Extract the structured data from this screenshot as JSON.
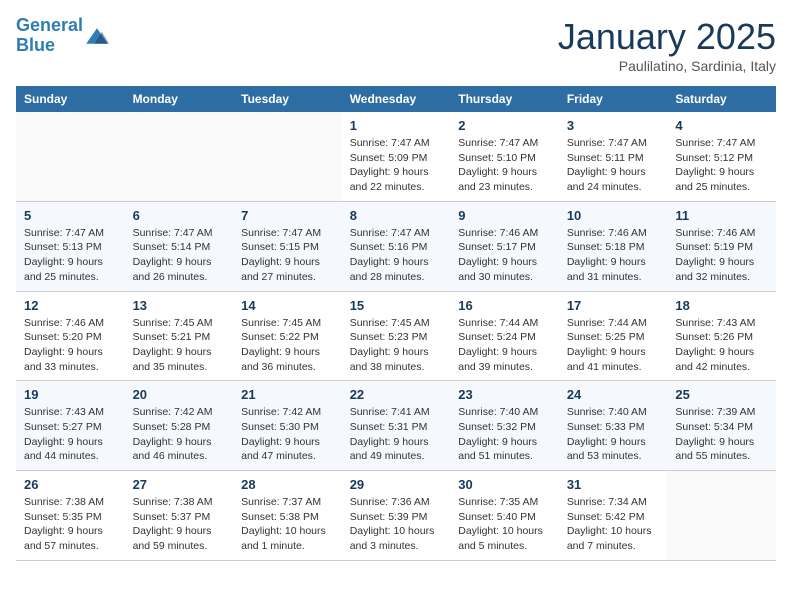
{
  "header": {
    "logo_line1": "General",
    "logo_line2": "Blue",
    "month_title": "January 2025",
    "subtitle": "Paulilatino, Sardinia, Italy"
  },
  "days_of_week": [
    "Sunday",
    "Monday",
    "Tuesday",
    "Wednesday",
    "Thursday",
    "Friday",
    "Saturday"
  ],
  "weeks": [
    {
      "days": [
        {
          "num": "",
          "info": ""
        },
        {
          "num": "",
          "info": ""
        },
        {
          "num": "",
          "info": ""
        },
        {
          "num": "1",
          "info": "Sunrise: 7:47 AM\nSunset: 5:09 PM\nDaylight: 9 hours and 22 minutes."
        },
        {
          "num": "2",
          "info": "Sunrise: 7:47 AM\nSunset: 5:10 PM\nDaylight: 9 hours and 23 minutes."
        },
        {
          "num": "3",
          "info": "Sunrise: 7:47 AM\nSunset: 5:11 PM\nDaylight: 9 hours and 24 minutes."
        },
        {
          "num": "4",
          "info": "Sunrise: 7:47 AM\nSunset: 5:12 PM\nDaylight: 9 hours and 25 minutes."
        }
      ]
    },
    {
      "days": [
        {
          "num": "5",
          "info": "Sunrise: 7:47 AM\nSunset: 5:13 PM\nDaylight: 9 hours and 25 minutes."
        },
        {
          "num": "6",
          "info": "Sunrise: 7:47 AM\nSunset: 5:14 PM\nDaylight: 9 hours and 26 minutes."
        },
        {
          "num": "7",
          "info": "Sunrise: 7:47 AM\nSunset: 5:15 PM\nDaylight: 9 hours and 27 minutes."
        },
        {
          "num": "8",
          "info": "Sunrise: 7:47 AM\nSunset: 5:16 PM\nDaylight: 9 hours and 28 minutes."
        },
        {
          "num": "9",
          "info": "Sunrise: 7:46 AM\nSunset: 5:17 PM\nDaylight: 9 hours and 30 minutes."
        },
        {
          "num": "10",
          "info": "Sunrise: 7:46 AM\nSunset: 5:18 PM\nDaylight: 9 hours and 31 minutes."
        },
        {
          "num": "11",
          "info": "Sunrise: 7:46 AM\nSunset: 5:19 PM\nDaylight: 9 hours and 32 minutes."
        }
      ]
    },
    {
      "days": [
        {
          "num": "12",
          "info": "Sunrise: 7:46 AM\nSunset: 5:20 PM\nDaylight: 9 hours and 33 minutes."
        },
        {
          "num": "13",
          "info": "Sunrise: 7:45 AM\nSunset: 5:21 PM\nDaylight: 9 hours and 35 minutes."
        },
        {
          "num": "14",
          "info": "Sunrise: 7:45 AM\nSunset: 5:22 PM\nDaylight: 9 hours and 36 minutes."
        },
        {
          "num": "15",
          "info": "Sunrise: 7:45 AM\nSunset: 5:23 PM\nDaylight: 9 hours and 38 minutes."
        },
        {
          "num": "16",
          "info": "Sunrise: 7:44 AM\nSunset: 5:24 PM\nDaylight: 9 hours and 39 minutes."
        },
        {
          "num": "17",
          "info": "Sunrise: 7:44 AM\nSunset: 5:25 PM\nDaylight: 9 hours and 41 minutes."
        },
        {
          "num": "18",
          "info": "Sunrise: 7:43 AM\nSunset: 5:26 PM\nDaylight: 9 hours and 42 minutes."
        }
      ]
    },
    {
      "days": [
        {
          "num": "19",
          "info": "Sunrise: 7:43 AM\nSunset: 5:27 PM\nDaylight: 9 hours and 44 minutes."
        },
        {
          "num": "20",
          "info": "Sunrise: 7:42 AM\nSunset: 5:28 PM\nDaylight: 9 hours and 46 minutes."
        },
        {
          "num": "21",
          "info": "Sunrise: 7:42 AM\nSunset: 5:30 PM\nDaylight: 9 hours and 47 minutes."
        },
        {
          "num": "22",
          "info": "Sunrise: 7:41 AM\nSunset: 5:31 PM\nDaylight: 9 hours and 49 minutes."
        },
        {
          "num": "23",
          "info": "Sunrise: 7:40 AM\nSunset: 5:32 PM\nDaylight: 9 hours and 51 minutes."
        },
        {
          "num": "24",
          "info": "Sunrise: 7:40 AM\nSunset: 5:33 PM\nDaylight: 9 hours and 53 minutes."
        },
        {
          "num": "25",
          "info": "Sunrise: 7:39 AM\nSunset: 5:34 PM\nDaylight: 9 hours and 55 minutes."
        }
      ]
    },
    {
      "days": [
        {
          "num": "26",
          "info": "Sunrise: 7:38 AM\nSunset: 5:35 PM\nDaylight: 9 hours and 57 minutes."
        },
        {
          "num": "27",
          "info": "Sunrise: 7:38 AM\nSunset: 5:37 PM\nDaylight: 9 hours and 59 minutes."
        },
        {
          "num": "28",
          "info": "Sunrise: 7:37 AM\nSunset: 5:38 PM\nDaylight: 10 hours and 1 minute."
        },
        {
          "num": "29",
          "info": "Sunrise: 7:36 AM\nSunset: 5:39 PM\nDaylight: 10 hours and 3 minutes."
        },
        {
          "num": "30",
          "info": "Sunrise: 7:35 AM\nSunset: 5:40 PM\nDaylight: 10 hours and 5 minutes."
        },
        {
          "num": "31",
          "info": "Sunrise: 7:34 AM\nSunset: 5:42 PM\nDaylight: 10 hours and 7 minutes."
        },
        {
          "num": "",
          "info": ""
        }
      ]
    }
  ]
}
